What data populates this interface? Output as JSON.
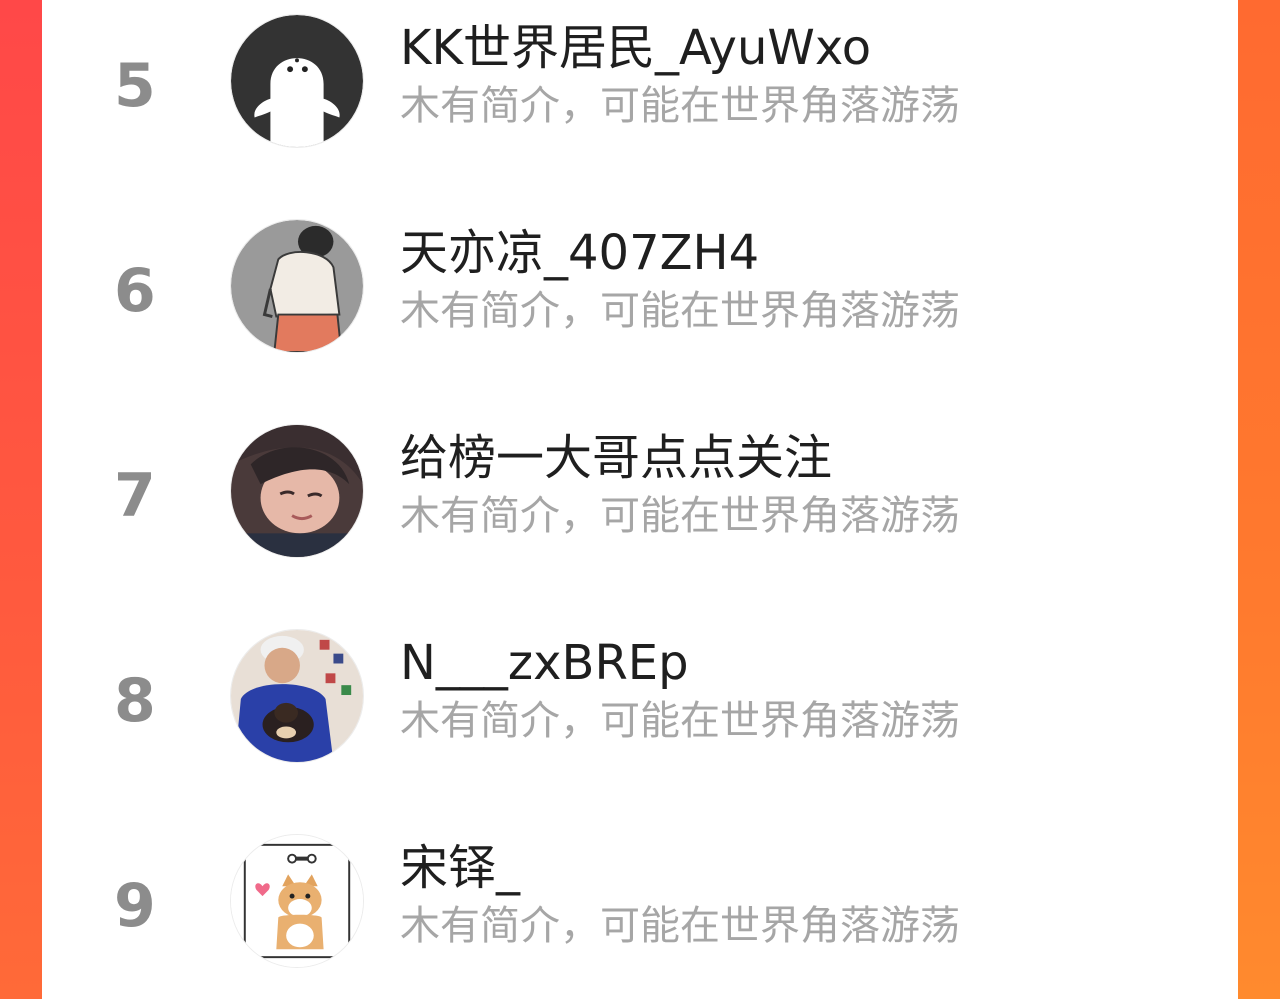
{
  "ranking": {
    "items": [
      {
        "rank": "5",
        "name": "KK世界居民_AyuWxo",
        "bio": "木有简介，可能在世界角落游荡",
        "avatar_icon": "ghost-avatar-icon"
      },
      {
        "rank": "6",
        "name": "天亦凉_407ZH4",
        "bio": "木有简介，可能在世界角落游荡",
        "avatar_icon": "person-back-avatar-icon"
      },
      {
        "rank": "7",
        "name": "给榜一大哥点点关注",
        "bio": "木有简介，可能在世界角落游荡",
        "avatar_icon": "anime-face-avatar-icon"
      },
      {
        "rank": "8",
        "name": "N___zxBREp",
        "bio": "木有简介，可能在世界角落游荡",
        "avatar_icon": "person-with-dog-avatar-icon"
      },
      {
        "rank": "9",
        "name": "宋铎_",
        "bio": "木有简介，可能在世界角落游荡",
        "avatar_icon": "shiba-dog-avatar-icon"
      }
    ]
  },
  "colors": {
    "left_edge": "#ff4848",
    "right_edge": "#ff7a2e",
    "rank_text": "#8c8c8c",
    "name_text": "#1f1f1f",
    "bio_text": "#a6a6a6"
  }
}
